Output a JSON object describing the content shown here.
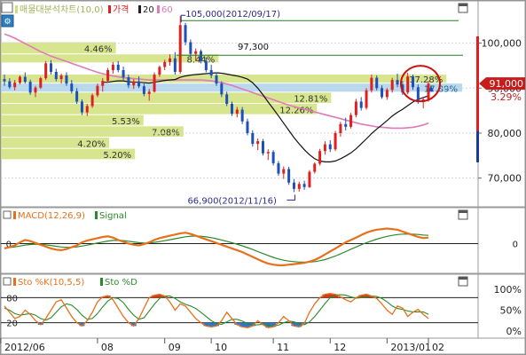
{
  "header": {
    "indicator_label": "매물대분석차트(10,0)",
    "price_label": "가격",
    "ma20_label": "20",
    "ma60_label": "60"
  },
  "colors": {
    "candle_up": "#e02020",
    "candle_down": "#1f4fb8",
    "ma20": "#111111",
    "ma60": "#e07ab8",
    "volume_band": "#cfe07a",
    "volume_band_main": "#a9d2ea",
    "macd": "#e8701c",
    "signal": "#2a8a2a",
    "stoch_k": "#e8701c",
    "stoch_d": "#2a8a2a",
    "highlight_circle": "#cc1111"
  },
  "chart_data": [
    {
      "type": "candlestick",
      "name": "price",
      "x_tick_labels": [
        "2012/06",
        "08",
        "09",
        "10",
        "11",
        "12",
        "2013/01",
        "02"
      ],
      "y_ticks": [
        70000,
        80000,
        90000,
        100000
      ],
      "y_tick_labels": [
        "70,000",
        "80,000",
        "90,000",
        "100,000"
      ],
      "ylim": [
        65000,
        108000
      ],
      "current_price": 91000,
      "current_price_label": "91,000",
      "change_label": "3.29%",
      "volume_profile": [
        {
          "price_low": 97500,
          "price_high": 100200,
          "label": "4.46%",
          "share": 4.46
        },
        {
          "price_low": 95500,
          "price_high": 97500,
          "label": "8.44%",
          "share": 8.44
        },
        {
          "price_low": 91000,
          "price_high": 93000,
          "label": "17.28%",
          "share": 17.28
        },
        {
          "price_low": 89000,
          "price_high": 91000,
          "label": "17.89%",
          "share": 17.89
        },
        {
          "price_low": 86500,
          "price_high": 89000,
          "label": "12.81%",
          "share": 12.81
        },
        {
          "price_low": 84000,
          "price_high": 86500,
          "label": "12.26%",
          "share": 12.26
        },
        {
          "price_low": 81500,
          "price_high": 84000,
          "label": "5.53%",
          "share": 5.53
        },
        {
          "price_low": 79000,
          "price_high": 81500,
          "label": "7.08%",
          "share": 7.08
        },
        {
          "price_low": 76500,
          "price_high": 79000,
          "label": "4.20%",
          "share": 4.2
        },
        {
          "price_low": 74000,
          "price_high": 76500,
          "label": "5.20%",
          "share": 5.2
        }
      ],
      "annotations": [
        {
          "text": "105,000(2012/09/17)",
          "price": 105000
        },
        {
          "text": "97,300",
          "price": 97300
        },
        {
          "text": "66,900(2012/11/16)",
          "price": 66900
        }
      ],
      "candles": [
        [
          92000,
          93000,
          90500,
          91500
        ],
        [
          91500,
          92200,
          89800,
          90200
        ],
        [
          90200,
          91800,
          89500,
          91200
        ],
        [
          91200,
          92800,
          90800,
          92500
        ],
        [
          92500,
          93500,
          91000,
          91400
        ],
        [
          91400,
          91900,
          88500,
          89000
        ],
        [
          89000,
          90500,
          88000,
          90100
        ],
        [
          90100,
          92500,
          89800,
          92200
        ],
        [
          92200,
          96000,
          91800,
          95500
        ],
        [
          95500,
          96200,
          93000,
          93600
        ],
        [
          93600,
          94300,
          91500,
          92000
        ],
        [
          92000,
          93200,
          91000,
          92800
        ],
        [
          92800,
          93500,
          90500,
          91000
        ],
        [
          91000,
          91800,
          88800,
          89300
        ],
        [
          89300,
          90000,
          86500,
          87000
        ],
        [
          87000,
          87500,
          84000,
          84600
        ],
        [
          84600,
          86500,
          83800,
          86000
        ],
        [
          86000,
          88800,
          85600,
          88400
        ],
        [
          88400,
          91000,
          88000,
          90500
        ],
        [
          90500,
          92200,
          89200,
          91600
        ],
        [
          91600,
          94500,
          91200,
          94000
        ],
        [
          94000,
          95800,
          93200,
          95200
        ],
        [
          95200,
          96000,
          93500,
          94000
        ],
        [
          94000,
          94800,
          91800,
          92400
        ],
        [
          92400,
          93000,
          90000,
          90600
        ],
        [
          90600,
          92000,
          89800,
          91500
        ],
        [
          91500,
          92600,
          90000,
          90400
        ],
        [
          90400,
          91000,
          88200,
          88700
        ],
        [
          88700,
          89800,
          87200,
          89200
        ],
        [
          89200,
          93500,
          89000,
          93000
        ],
        [
          93000,
          95000,
          92500,
          94700
        ],
        [
          94700,
          96300,
          94000,
          95800
        ],
        [
          95800,
          97500,
          95000,
          96600
        ],
        [
          96600,
          98000,
          93000,
          93600
        ],
        [
          93600,
          106000,
          93200,
          104000
        ],
        [
          104000,
          104500,
          99500,
          100200
        ],
        [
          100200,
          100800,
          97000,
          97600
        ],
        [
          97600,
          98800,
          96000,
          98200
        ],
        [
          98200,
          98600,
          95500,
          96000
        ],
        [
          96000,
          96800,
          93500,
          94000
        ],
        [
          94000,
          95200,
          92200,
          92800
        ],
        [
          92800,
          93500,
          90500,
          91000
        ],
        [
          91000,
          91500,
          88000,
          88600
        ],
        [
          88600,
          89200,
          86000,
          86500
        ],
        [
          86500,
          87000,
          83800,
          84300
        ],
        [
          84300,
          85800,
          83500,
          85200
        ],
        [
          85200,
          85800,
          82000,
          82600
        ],
        [
          82600,
          83200,
          79500,
          80000
        ],
        [
          80000,
          80600,
          77000,
          77600
        ],
        [
          77600,
          78800,
          76200,
          78200
        ],
        [
          78200,
          78700,
          75000,
          75500
        ],
        [
          75500,
          76400,
          74000,
          75800
        ],
        [
          75800,
          76200,
          72800,
          73300
        ],
        [
          73300,
          73800,
          70500,
          71000
        ],
        [
          71000,
          72600,
          69800,
          72000
        ],
        [
          72000,
          72500,
          68500,
          69000
        ],
        [
          69000,
          69800,
          66900,
          67600
        ],
        [
          67600,
          69200,
          67000,
          68700
        ],
        [
          68700,
          69400,
          67400,
          68000
        ],
        [
          68000,
          71800,
          67800,
          71400
        ],
        [
          71400,
          73500,
          71000,
          73200
        ],
        [
          73200,
          76500,
          72800,
          76000
        ],
        [
          76000,
          78200,
          75200,
          77500
        ],
        [
          77500,
          78400,
          75800,
          76400
        ],
        [
          76400,
          80500,
          76000,
          80000
        ],
        [
          80000,
          82500,
          79200,
          82000
        ],
        [
          82000,
          83400,
          80600,
          81400
        ],
        [
          81400,
          84500,
          81000,
          84000
        ],
        [
          84000,
          87600,
          83500,
          87000
        ],
        [
          87000,
          88000,
          85000,
          85600
        ],
        [
          85600,
          90000,
          85200,
          89500
        ],
        [
          89500,
          93000,
          89000,
          92300
        ],
        [
          92300,
          92800,
          89500,
          90000
        ],
        [
          90000,
          90600,
          87600,
          88000
        ],
        [
          88000,
          90000,
          87400,
          89600
        ],
        [
          89600,
          92300,
          89000,
          91800
        ],
        [
          91800,
          93200,
          90200,
          90800
        ],
        [
          90800,
          91600,
          88500,
          89000
        ],
        [
          89000,
          93400,
          88600,
          92600
        ],
        [
          92600,
          93000,
          89600,
          90200
        ],
        [
          90200,
          90800,
          86500,
          87000
        ],
        [
          87000,
          88000,
          85500,
          87500
        ],
        [
          87500,
          91600,
          87000,
          91000
        ]
      ],
      "ma20": [
        null,
        null,
        null,
        null,
        null,
        null,
        null,
        null,
        null,
        null,
        null,
        null,
        null,
        null,
        null,
        null,
        null,
        null,
        null,
        91300,
        91300,
        91500,
        91600,
        91600,
        91400,
        91300,
        91300,
        91200,
        91100,
        91300,
        91500,
        91700,
        91800,
        91900,
        92400,
        92700,
        92900,
        93000,
        93100,
        93200,
        93300,
        93400,
        93300,
        93100,
        92900,
        92700,
        92400,
        92000,
        91200,
        90000,
        88500,
        86900,
        85400,
        83800,
        82200,
        80600,
        79000,
        77600,
        76300,
        75200,
        74300,
        73800,
        73600,
        73600,
        73800,
        74300,
        74900,
        75600,
        76500,
        77600,
        78700,
        79900,
        80900,
        81800,
        82800,
        83800,
        84600,
        85300,
        86100,
        86900,
        87500,
        87900,
        88300
      ],
      "ma60": [
        102000,
        101600,
        101100,
        100500,
        99900,
        99300,
        98700,
        98100,
        97600,
        97100,
        96700,
        96300,
        95900,
        95500,
        95100,
        94700,
        94300,
        93900,
        93500,
        93200,
        92900,
        92700,
        92500,
        92300,
        92200,
        92100,
        92000,
        91900,
        91800,
        91800,
        91800,
        91800,
        91800,
        91800,
        91800,
        91800,
        91800,
        91800,
        91800,
        91700,
        91600,
        91400,
        91200,
        90900,
        90600,
        90200,
        89800,
        89400,
        89000,
        88600,
        88200,
        87800,
        87400,
        87000,
        86600,
        86200,
        85900,
        85600,
        85300,
        85000,
        84700,
        84400,
        84100,
        83800,
        83500,
        83200,
        82900,
        82600,
        82300,
        82000,
        81800,
        81600,
        81400,
        81300,
        81200,
        81100,
        81100,
        81100,
        81200,
        81300,
        81500,
        81800,
        82200
      ]
    },
    {
      "type": "line",
      "name": "MACD(12,26,9)",
      "label": "MACD(12,26,9)",
      "signal_label": "Signal",
      "y_ticks": [
        0
      ],
      "y_tick_labels": [
        "0"
      ],
      "ylim": [
        -4200,
        3600
      ],
      "series": [
        {
          "name": "MACD",
          "values": [
            -800,
            -600,
            -300,
            200,
            600,
            400,
            100,
            -200,
            -500,
            -800,
            -1000,
            -1100,
            -900,
            -600,
            -300,
            200,
            500,
            700,
            900,
            1100,
            1200,
            1000,
            600,
            300,
            0,
            -200,
            -300,
            -100,
            200,
            600,
            900,
            1100,
            1300,
            1500,
            1700,
            1800,
            1600,
            1300,
            1000,
            700,
            400,
            100,
            -200,
            -500,
            -800,
            -1100,
            -1400,
            -1800,
            -2200,
            -2600,
            -3000,
            -3300,
            -3500,
            -3600,
            -3600,
            -3500,
            -3400,
            -3300,
            -3200,
            -3000,
            -2700,
            -2300,
            -1800,
            -1300,
            -800,
            -300,
            200,
            600,
            1000,
            1400,
            1800,
            2100,
            2300,
            2400,
            2500,
            2400,
            2300,
            2000,
            1700,
            1400,
            1100,
            900,
            1000
          ]
        },
        {
          "name": "Signal",
          "values": [
            -700,
            -650,
            -550,
            -400,
            -250,
            -150,
            -100,
            -120,
            -200,
            -320,
            -450,
            -560,
            -620,
            -610,
            -550,
            -420,
            -250,
            -80,
            80,
            260,
            420,
            520,
            540,
            490,
            390,
            270,
            160,
            100,
            110,
            200,
            330,
            480,
            640,
            800,
            970,
            1130,
            1230,
            1260,
            1220,
            1120,
            980,
            800,
            600,
            380,
            140,
            -110,
            -380,
            -670,
            -980,
            -1310,
            -1650,
            -1980,
            -2290,
            -2550,
            -2760,
            -2900,
            -3000,
            -3060,
            -3080,
            -3070,
            -3000,
            -2850,
            -2650,
            -2380,
            -2070,
            -1710,
            -1330,
            -940,
            -560,
            -200,
            140,
            450,
            730,
            980,
            1200,
            1370,
            1500,
            1570,
            1600,
            1570,
            1510,
            1420,
            1370
          ]
        }
      ]
    },
    {
      "type": "line",
      "name": "Sto %K(10,5,5)",
      "label": "Sto %K(10,5,5)",
      "d_label": "Sto %D",
      "y_ticks": [
        0,
        50,
        100
      ],
      "y_tick_labels": [
        "0%",
        "50%",
        "100%"
      ],
      "ref_lines": [
        20,
        80
      ],
      "ref_labels": [
        "20",
        "80"
      ],
      "ylim": [
        0,
        100
      ],
      "series": [
        {
          "name": "Sto %K",
          "values": [
            60,
            45,
            30,
            35,
            50,
            40,
            25,
            15,
            30,
            50,
            70,
            75,
            55,
            35,
            20,
            12,
            25,
            45,
            70,
            82,
            85,
            75,
            55,
            35,
            20,
            12,
            30,
            55,
            80,
            86,
            88,
            84,
            70,
            50,
            65,
            60,
            45,
            30,
            20,
            12,
            10,
            12,
            25,
            45,
            30,
            15,
            10,
            8,
            12,
            25,
            15,
            8,
            10,
            20,
            35,
            25,
            12,
            10,
            18,
            45,
            65,
            80,
            88,
            90,
            88,
            82,
            75,
            70,
            80,
            86,
            88,
            84,
            78,
            65,
            50,
            40,
            60,
            55,
            35,
            45,
            52,
            40,
            30
          ]
        },
        {
          "name": "Sto %D",
          "values": [
            55,
            50,
            42,
            38,
            40,
            42,
            38,
            30,
            26,
            32,
            45,
            58,
            65,
            62,
            52,
            38,
            28,
            30,
            42,
            58,
            72,
            80,
            78,
            68,
            52,
            38,
            28,
            32,
            48,
            64,
            78,
            84,
            84,
            78,
            70,
            64,
            60,
            54,
            45,
            35,
            25,
            18,
            16,
            22,
            28,
            28,
            24,
            18,
            14,
            15,
            16,
            14,
            12,
            14,
            20,
            24,
            22,
            18,
            15,
            22,
            35,
            50,
            66,
            80,
            86,
            87,
            86,
            82,
            79,
            80,
            82,
            84,
            83,
            78,
            70,
            60,
            54,
            52,
            48,
            46,
            46,
            46,
            40
          ]
        }
      ]
    }
  ]
}
